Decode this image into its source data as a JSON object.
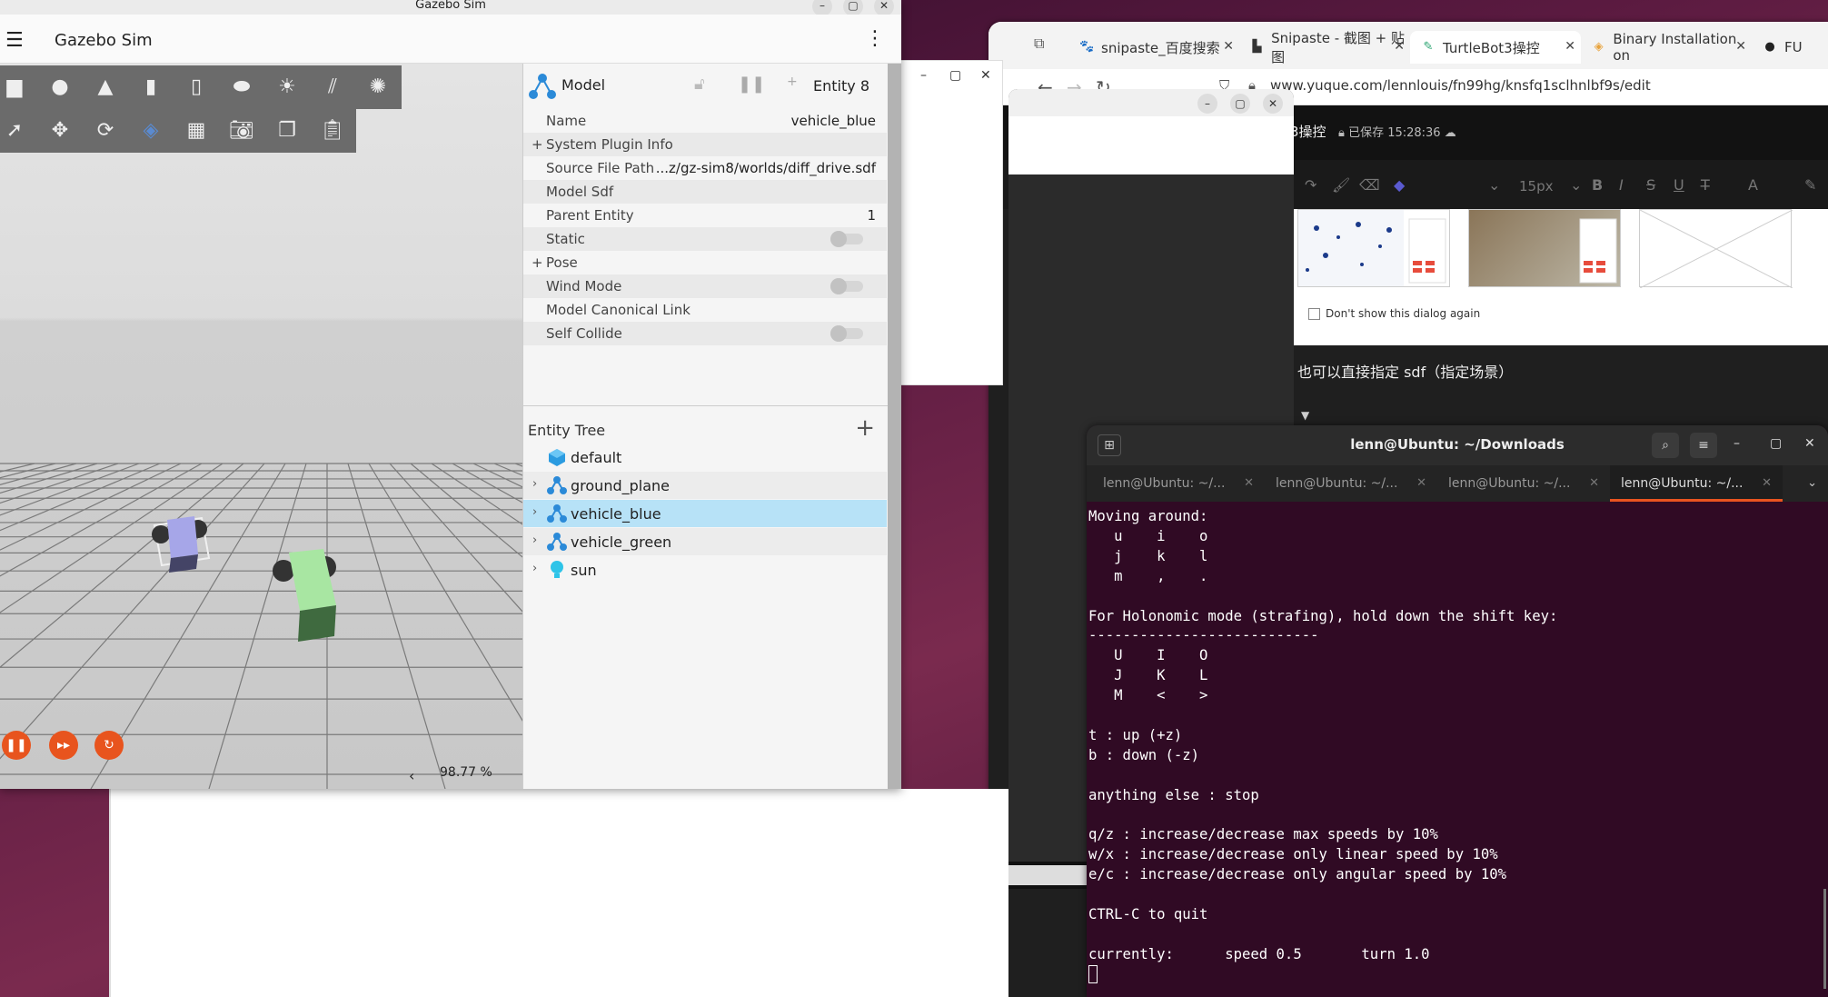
{
  "gazebo": {
    "title": "Gazebo Sim",
    "window_buttons": [
      "–",
      "▢",
      "✕"
    ],
    "app_name": "Gazebo Sim",
    "real_time_factor": "98.77 %",
    "component_inspector": {
      "type_label": "Model",
      "entity_label": "Entity 8",
      "properties": [
        {
          "key": "Name",
          "value": "vehicle_blue",
          "kind": "text"
        },
        {
          "key": "System Plugin Info",
          "value": "",
          "kind": "expand"
        },
        {
          "key": "Source File Path",
          "value": "...z/gz-sim8/worlds/diff_drive.sdf",
          "kind": "text"
        },
        {
          "key": "Model Sdf",
          "value": "",
          "kind": "text"
        },
        {
          "key": "Parent Entity",
          "value": "1",
          "kind": "text"
        },
        {
          "key": "Static",
          "value": "off",
          "kind": "toggle"
        },
        {
          "key": "Pose",
          "value": "",
          "kind": "expand"
        },
        {
          "key": "Wind Mode",
          "value": "off",
          "kind": "toggle"
        },
        {
          "key": "Model Canonical Link",
          "value": "",
          "kind": "text"
        },
        {
          "key": "Self Collide",
          "value": "off",
          "kind": "toggle"
        }
      ]
    },
    "entity_tree": {
      "title": "Entity Tree",
      "add_label": "+",
      "items": [
        {
          "label": "default",
          "icon": "world-icon",
          "expandable": false,
          "selected": false
        },
        {
          "label": "ground_plane",
          "icon": "model-icon",
          "expandable": true,
          "selected": false
        },
        {
          "label": "vehicle_blue",
          "icon": "model-icon",
          "expandable": true,
          "selected": true
        },
        {
          "label": "vehicle_green",
          "icon": "model-icon",
          "expandable": true,
          "selected": false
        },
        {
          "label": "sun",
          "icon": "light-icon",
          "expandable": true,
          "selected": false
        }
      ]
    }
  },
  "browser": {
    "tabs": [
      {
        "label": "snipaste_百度搜索",
        "fav": "🐾"
      },
      {
        "label": "Snipaste - 截图 + 贴图",
        "fav": "▙"
      },
      {
        "label": "TurtleBot3操控",
        "fav": "✎"
      },
      {
        "label": "Binary Installation on",
        "fav": "◈"
      },
      {
        "label": "FU",
        "fav": "●"
      }
    ],
    "url": "www.yuque.com/lennlouis/fn99hg/knsfq1sclhnlbf9s/edit",
    "doc_title": "3操控",
    "saved_status": "已保存 15:28:36",
    "font_size": "15px",
    "dont_show_label": "Don't show this dialog again",
    "content_line": "也可以直接指定 sdf（指定场景）"
  },
  "terminal": {
    "title": "lenn@Ubuntu: ~/Downloads",
    "tabs": [
      "lenn@Ubuntu: ~/...",
      "lenn@Ubuntu: ~/...",
      "lenn@Ubuntu: ~/...",
      "lenn@Ubuntu: ~/..."
    ],
    "active_tab_index": 3,
    "lines": [
      "Moving around:",
      "   u    i    o",
      "   j    k    l",
      "   m    ,    .",
      "",
      "For Holonomic mode (strafing), hold down the shift key:",
      "---------------------------",
      "   U    I    O",
      "   J    K    L",
      "   M    <    >",
      "",
      "t : up (+z)",
      "b : down (-z)",
      "",
      "anything else : stop",
      "",
      "q/z : increase/decrease max speeds by 10%",
      "w/x : increase/decrease only linear speed by 10%",
      "e/c : increase/decrease only angular speed by 10%",
      "",
      "CTRL-C to quit",
      "",
      "currently:      speed 0.5       turn 1.0"
    ]
  },
  "colors": {
    "gazebo_accent": "#e8541e",
    "selection": "#b7e2f7",
    "terminal_bg": "#300a24",
    "ubuntu_orange": "#e95420"
  }
}
